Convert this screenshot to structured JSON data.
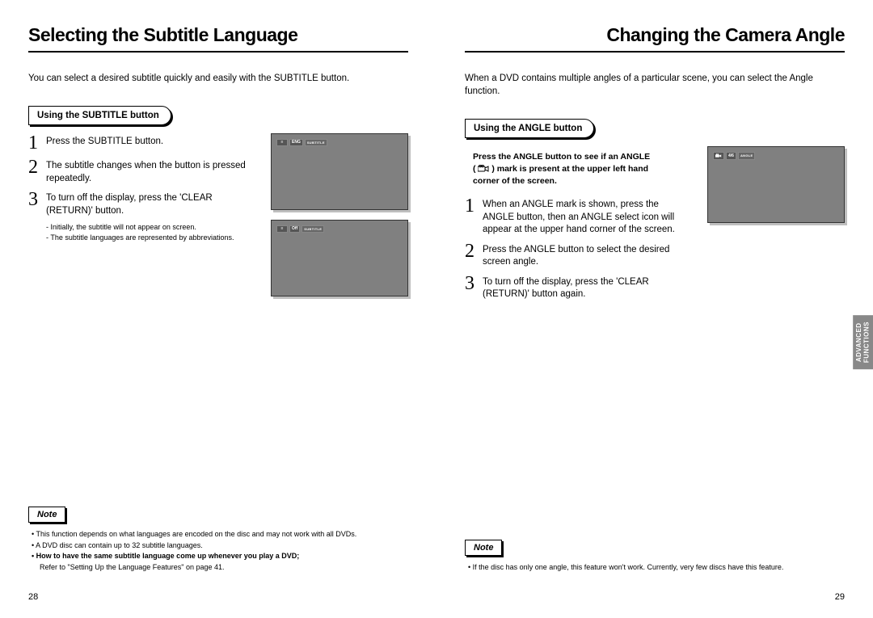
{
  "left": {
    "title": "Selecting the Subtitle Language",
    "intro": "You can select a desired subtitle quickly and easily with the SUBTITLE button.",
    "section_tab": "Using the SUBTITLE button",
    "steps": [
      "Press the SUBTITLE button.",
      "The subtitle changes when the button is pressed repeatedly.",
      "To turn off the display, press the 'CLEAR (RETURN)' button."
    ],
    "subnotes": [
      "- Initially, the subtitle will not appear on screen.",
      "- The subtitle languages are represented by abbreviations."
    ],
    "screen1": {
      "val": "ENG",
      "label": "SUBTITLE"
    },
    "screen2": {
      "val": "Off",
      "label": "SUBTITLE"
    },
    "note_label": "Note",
    "notes": {
      "n1": "• This function depends on what languages are encoded on the disc and may not work with all DVDs.",
      "n2": "• A DVD disc can contain up to 32 subtitle languages.",
      "n3": "• How to have the same subtitle language come up whenever you play a DVD;",
      "n3sub": "Refer to \"Setting Up the Language Features\" on page 41."
    },
    "page_no": "28"
  },
  "right": {
    "title": "Changing the Camera Angle",
    "intro": "When a DVD contains multiple angles of a particular scene, you can select the Angle function.",
    "section_tab": "Using the ANGLE button",
    "instr_l1": "Press the ANGLE button to see if an ANGLE",
    "instr_l2a": "( ",
    "instr_l2b": " ) mark is present at the upper left hand",
    "instr_l3": "corner of the screen.",
    "steps": [
      "When an ANGLE mark is shown, press the ANGLE button, then an ANGLE select icon will appear at the upper hand corner of the screen.",
      "Press the ANGLE button to select the desired screen angle.",
      "To turn off the display, press the 'CLEAR (RETURN)' button again."
    ],
    "screen": {
      "val": "4/6",
      "label": "ANGLE"
    },
    "note_label": "Note",
    "note_text": "• If the disc has only one angle, this feature won't work. Currently, very few discs have this feature.",
    "page_no": "29",
    "side_tab_l1": "ADVANCED",
    "side_tab_l2": "FUNCTIONS"
  }
}
